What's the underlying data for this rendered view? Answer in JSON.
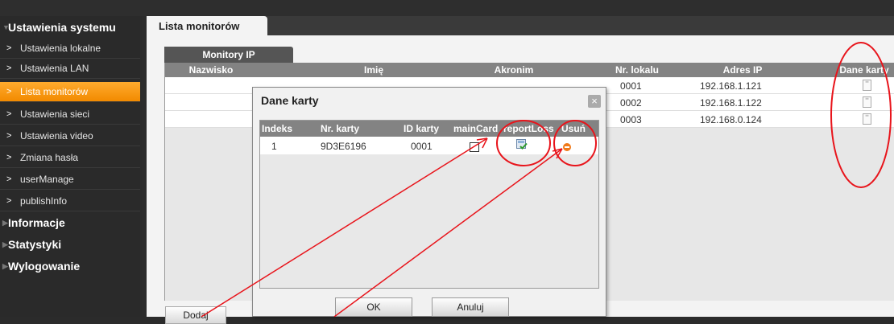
{
  "sidebar": {
    "sections": [
      {
        "label": "Ustawienia systemu"
      },
      {
        "label": "Informacje"
      },
      {
        "label": "Statystyki"
      },
      {
        "label": "Wylogowanie"
      }
    ],
    "items": [
      {
        "label": "Ustawienia lokalne"
      },
      {
        "label": "Ustawienia LAN"
      },
      {
        "label": "Lista monitorów"
      },
      {
        "label": "Ustawienia sieci"
      },
      {
        "label": "Ustawienia video"
      },
      {
        "label": "Zmiana hasła"
      },
      {
        "label": "userManage"
      },
      {
        "label": "publishInfo"
      }
    ]
  },
  "main": {
    "tab_label": "Lista monitorów",
    "subtab_label": "Monitory IP",
    "columns": [
      "Nazwisko",
      "Imię",
      "Akronim",
      "Nr. lokalu",
      "Adres IP",
      "Dane karty"
    ],
    "rows": [
      {
        "lokal": "0001",
        "ip": "192.168.1.121"
      },
      {
        "lokal": "0002",
        "ip": "192.168.1.122"
      },
      {
        "lokal": "0003",
        "ip": "192.168.0.124"
      }
    ],
    "add_button": "Dodaj"
  },
  "dialog": {
    "title": "Dane karty",
    "columns": [
      "Indeks",
      "Nr. karty",
      "ID karty",
      "mainCard",
      "reportLoss",
      "Usuń"
    ],
    "row": {
      "index": "1",
      "card_no": "9D3E6196",
      "card_id": "0001"
    },
    "ok": "OK",
    "cancel": "Anuluj"
  },
  "colors": {
    "active_item": "#f28a00",
    "annotation": "#e8141b",
    "header_bg": "#838383"
  }
}
